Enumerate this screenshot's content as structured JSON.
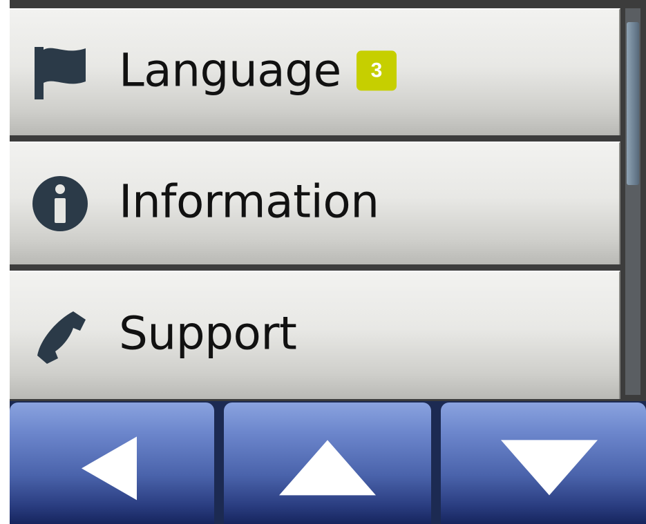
{
  "menu": {
    "items": [
      {
        "label": "Language",
        "icon": "flag-icon",
        "badge": "3"
      },
      {
        "label": "Information",
        "icon": "info-icon"
      },
      {
        "label": "Support",
        "icon": "phone-icon"
      }
    ]
  },
  "navbar": {
    "buttons": [
      {
        "icon": "back-arrow-icon"
      },
      {
        "icon": "up-arrow-icon"
      },
      {
        "icon": "down-arrow-icon"
      }
    ]
  },
  "colors": {
    "badge": "#c6cf00",
    "icon": "#2b3a48",
    "nav_button": "#4a63ab"
  }
}
